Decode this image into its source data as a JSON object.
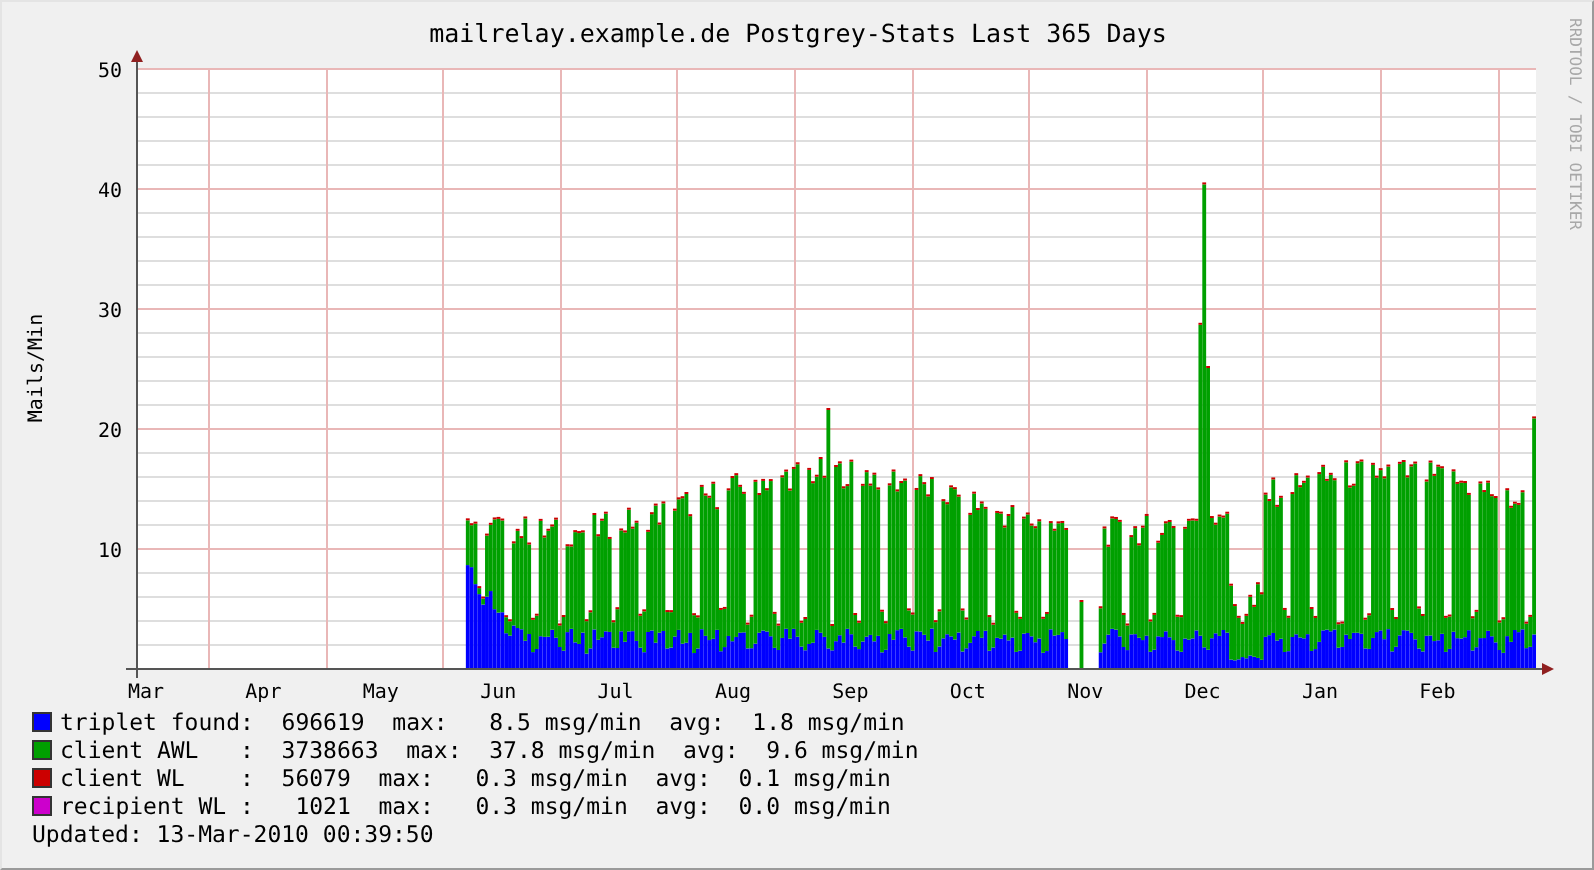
{
  "title": "mailrelay.example.de Postgrey-Stats Last 365 Days",
  "y_axis": {
    "label": "Mails/Min",
    "ticks": [
      "50",
      "40",
      "30",
      "20",
      "10"
    ]
  },
  "x_axis": {
    "ticks": [
      "Mar",
      "Apr",
      "May",
      "Jun",
      "Jul",
      "Aug",
      "Sep",
      "Oct",
      "Nov",
      "Dec",
      "Jan",
      "Feb"
    ]
  },
  "side_note": "RRDTOOL / TOBI OETIKER",
  "legend": [
    {
      "text": "triplet found:  696619  max:   8.5 msg/min  avg:  1.8 msg/min",
      "color": "#0000ff"
    },
    {
      "text": "client AWL   :  3738663  max:  37.8 msg/min  avg:  9.6 msg/min",
      "color": "#00a000"
    },
    {
      "text": "client WL    :  56079  max:   0.3 msg/min  avg:  0.1 msg/min",
      "color": "#cc0000"
    },
    {
      "text": "recipient WL :   1021  max:   0.3 msg/min  avg:  0.0 msg/min",
      "color": "#cc00cc"
    }
  ],
  "updated": "Updated: 13-Mar-2010 00:39:50"
}
